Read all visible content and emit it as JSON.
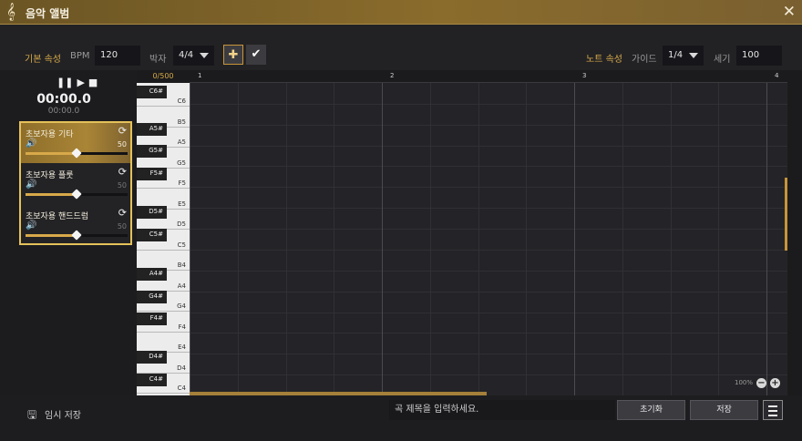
{
  "window": {
    "title": "음악 앨범",
    "clef_icon": "treble-clef-icon",
    "close_icon": "close-icon"
  },
  "toolbar": {
    "basic_props_label": "기본 속성",
    "bpm_label": "BPM",
    "bpm_value": "120",
    "beat_label": "박자",
    "beat_value": "4/4",
    "add_icon": "plus-icon",
    "check_icon": "check-icon",
    "note_props_label": "노트 속성",
    "guide_label": "가이드",
    "guide_value": "1/4",
    "strength_label": "세기",
    "strength_value": "100"
  },
  "player": {
    "time_main": "00:00.0",
    "time_sub": "00:00.0"
  },
  "tracks": [
    {
      "name": "초보자용 기타",
      "volume": "50",
      "volume_fraction": 0.5,
      "selected": true
    },
    {
      "name": "초보자용 플룻",
      "volume": "50",
      "volume_fraction": 0.5,
      "selected": false
    },
    {
      "name": "초보자용 핸드드럼",
      "volume": "50",
      "volume_fraction": 0.5,
      "selected": false
    }
  ],
  "keyboard": {
    "counter": "0/500",
    "white_keys": [
      "B5",
      "A5",
      "G5",
      "F5",
      "E5",
      "D5",
      "C5",
      "B4",
      "A4",
      "G4",
      "F4",
      "E4",
      "D4",
      "C4"
    ],
    "top_white": "C6",
    "black_keys": [
      "C6#",
      "A5#",
      "G5#",
      "F5#",
      "D5#",
      "C5#",
      "A4#",
      "G4#",
      "F4#",
      "D4#",
      "C4#"
    ]
  },
  "ruler": {
    "measures": [
      "1",
      "2",
      "3",
      "4"
    ]
  },
  "zoom": {
    "value": "100%",
    "minus_icon": "minus-icon",
    "plus_icon": "plus-icon"
  },
  "footer": {
    "temp_save_icon": "floppy-disk-icon",
    "temp_save_label": "임시 저장",
    "title_placeholder": "곡 제목을 입력하세요.",
    "reset_label": "초기화",
    "save_label": "저장",
    "menu_icon": "hamburger-menu-icon"
  },
  "colors": {
    "accent": "#d8aa48",
    "title_bar": "#7a6030",
    "selection": "#e4c15a"
  }
}
